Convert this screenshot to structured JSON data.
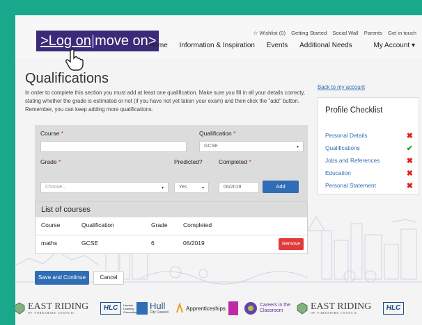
{
  "header": {
    "logo_part1": ">Log on",
    "logo_sep": "|",
    "logo_part2": "move on>",
    "top_links": [
      "Wishlist (0)",
      "Getting Started",
      "Social Wall",
      "Parents",
      "Get in touch"
    ],
    "main_nav": [
      "Home",
      "Information & Inspiration",
      "Events",
      "Additional Needs",
      "My Account"
    ]
  },
  "page": {
    "title": "Qualifications",
    "intro": "In order to complete this section you must add at least one qualification. Make sure you fill in all your details correcty, stating whether the grade is estimated or not (if you have not yet taken your exam) and then click the \"add\" button. Remember, you can keep adding more qualifications."
  },
  "form": {
    "course_label": "Course",
    "course_value": "",
    "qualification_label": "Qualification",
    "qualification_value": "GCSE",
    "grade_label": "Grade",
    "grade_placeholder": "Choose...",
    "predicted_label": "Predicted?",
    "predicted_value": "Yes",
    "completed_label": "Completed",
    "completed_value": "06/2019",
    "add_label": "Add",
    "required_mark": "*"
  },
  "list": {
    "title": "List of courses",
    "columns": [
      "Course",
      "Qualification",
      "Grade",
      "Completed"
    ],
    "rows": [
      {
        "course": "maths",
        "qualification": "GCSE",
        "grade": "6",
        "completed": "06/2019",
        "action": "Remove"
      }
    ]
  },
  "actions": {
    "save_label": "Save and Continue",
    "cancel_label": "Cancel"
  },
  "sidebar": {
    "back_link": "Back to my account",
    "checklist_title": "Profile Checklist",
    "items": [
      {
        "label": "Personal Details",
        "status": "incomplete",
        "mark": "✖"
      },
      {
        "label": "Qualifications",
        "status": "complete",
        "mark": "✔"
      },
      {
        "label": "Jobs and References",
        "status": "incomplete",
        "mark": "✖"
      },
      {
        "label": "Education",
        "status": "incomplete",
        "mark": "✖"
      },
      {
        "label": "Personal Statement",
        "status": "incomplete",
        "mark": "✖"
      }
    ]
  },
  "footer": {
    "logos": [
      "EAST RIDING",
      "OF YORKSHIRE COUNCIL",
      "HLC",
      "Humber Learning Consortium",
      "Hull",
      "City Council",
      "Apprenticeships",
      "Careers in the",
      "Classroom"
    ]
  },
  "colors": {
    "frame": "#1aa88d",
    "brand_purple": "#3a2a78",
    "primary_blue": "#2f6db5",
    "danger_red": "#e03b3b",
    "success_green": "#2a9a2a"
  }
}
